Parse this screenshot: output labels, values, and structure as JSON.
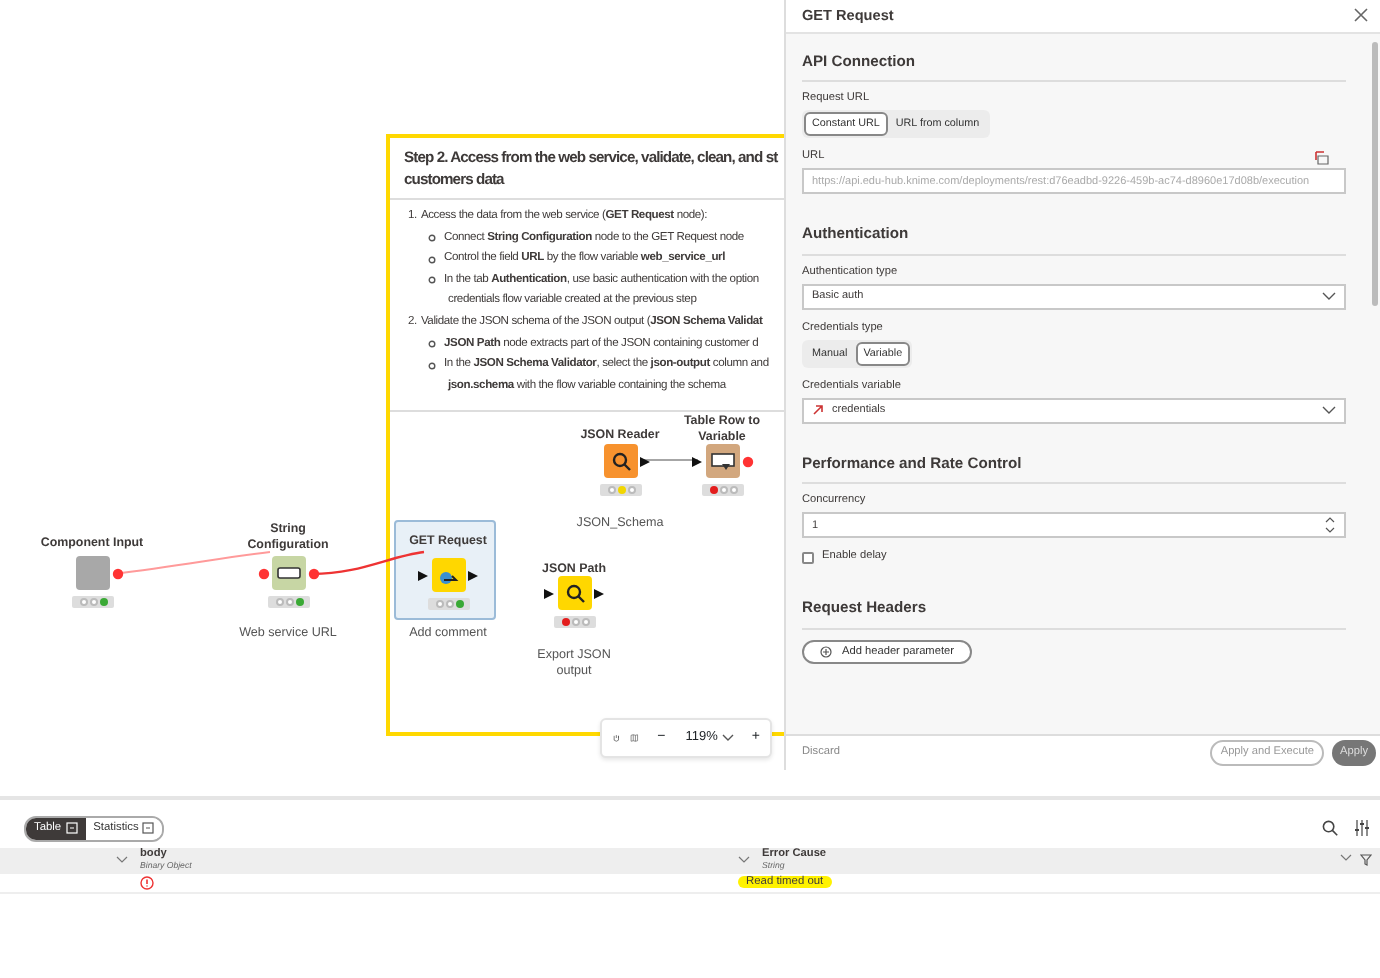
{
  "annotation": {
    "title": "Step 2. Access from the web service, validate, clean, and st",
    "title_2": "customers data",
    "items": [
      {
        "kind": "number",
        "marker": "1.",
        "text": "Access the data from the web service (**GET Request** node):"
      },
      {
        "kind": "bullet",
        "text": "Connect **String Configuration** node to the GET Request node"
      },
      {
        "kind": "bullet",
        "text": "Control the field **URL** by the flow variable **web_service_url**"
      },
      {
        "kind": "bullet",
        "text": "In the tab **Authentication**, use basic authentication with the option"
      },
      {
        "kind": "continuation",
        "text": "credentials flow variable created at the previous step"
      },
      {
        "kind": "number",
        "marker": "2.",
        "text": "Validate the JSON schema of the JSON output (**JSON Schema Validat**"
      },
      {
        "kind": "bullet",
        "text": "**JSON Path** node extracts part of the JSON containing customer d"
      },
      {
        "kind": "bullet",
        "text": "In the **JSON Schema Validator**, select the **json-output** column and"
      },
      {
        "kind": "continuation",
        "text": "**json.schema** with the flow variable containing the schema"
      }
    ]
  },
  "nodes": [
    {
      "title": "Component Input",
      "color": "#a8a8a8",
      "status_light": {
        "color": "#3aa935"
      },
      "selected": false
    },
    {
      "title": "String Configuration",
      "color": "#c7d6a4",
      "status_light": {
        "color": "#3aa935"
      },
      "selected": false,
      "comment": "Web service URL"
    },
    {
      "title": "GET Request",
      "color": "#ffd700",
      "status_light": {
        "color": "#3aa935"
      },
      "selected": true,
      "comment": "Add comment"
    },
    {
      "title": "JSON Path",
      "color": "#ffd700",
      "status_light": {
        "color": "#e31d1d"
      },
      "selected": false,
      "comment": "Export JSON output"
    },
    {
      "title": "JSON Reader",
      "color": "#f7922e",
      "status_light": {
        "color": "#f2d600"
      },
      "selected": false,
      "comment": "JSON_Schema"
    },
    {
      "title": "Table Row to Variable",
      "color": "#d2a77e",
      "status_light": {
        "color": "#e31d1d"
      },
      "selected": false
    }
  ],
  "zoom": {
    "minus": "−",
    "value": "119%",
    "plus": "+"
  },
  "panel": {
    "title": "GET Request",
    "sections": [
      {
        "heading": "API Connection",
        "fields": [
          {
            "kind": "toggle",
            "label": "Request URL",
            "options": [
              {
                "label": "Constant URL",
                "selected": true
              },
              {
                "label": "URL from column",
                "selected": false
              }
            ]
          },
          {
            "kind": "text",
            "label": "URL",
            "placeholder": "https://api.edu-hub.knime.com/deployments/rest:d76eadbd-9226-459b-ac74-d8960e17d08b/execution"
          }
        ]
      },
      {
        "heading": "Authentication",
        "fields": [
          {
            "kind": "select",
            "label": "Authentication type",
            "value": "Basic auth"
          },
          {
            "kind": "toggle",
            "label": "Credentials type",
            "options": [
              {
                "label": "Manual",
                "selected": false
              },
              {
                "label": "Variable",
                "selected": true
              }
            ]
          },
          {
            "kind": "select",
            "label": "Credentials variable",
            "value": "credentials",
            "variable": true
          }
        ]
      },
      {
        "heading": "Performance and Rate Control",
        "fields": [
          {
            "kind": "number",
            "label": "Concurrency",
            "value": "1"
          },
          {
            "kind": "checkbox",
            "label": "Enable delay",
            "checked": false
          }
        ]
      },
      {
        "heading": "Request Headers",
        "fields": [
          {
            "kind": "button",
            "label": "Add header parameter"
          }
        ]
      }
    ],
    "discard": "Discard",
    "apply_execute": "Apply and Execute",
    "apply": "Apply"
  },
  "table": {
    "tabs": [
      {
        "label": "Table",
        "selected": true
      },
      {
        "label": "Statistics",
        "selected": false
      }
    ],
    "columns": [
      {
        "name": "body",
        "type": "Binary Object"
      },
      {
        "name": "Error Cause",
        "type": "String"
      }
    ],
    "rows": [
      {
        "cells": [
          {
            "kind": "error"
          },
          {
            "kind": "text",
            "text": "Read timed out",
            "highlighted": true
          }
        ]
      }
    ]
  }
}
